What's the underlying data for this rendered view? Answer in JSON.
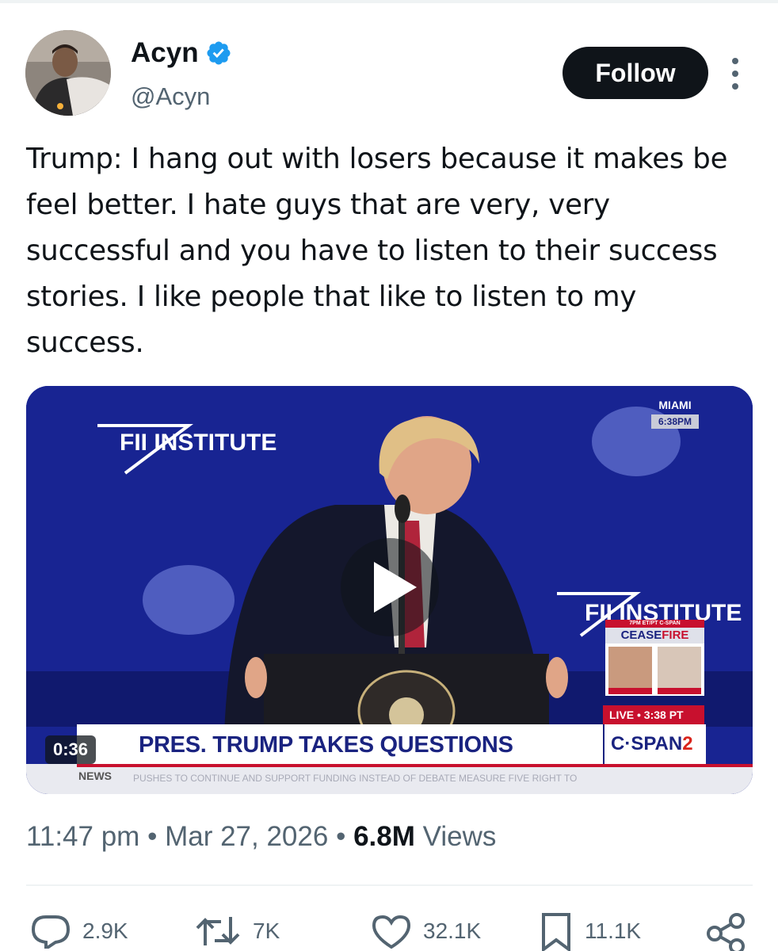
{
  "author": {
    "name": "Acyn",
    "handle": "@Acyn",
    "verified": true,
    "follow_label": "Follow"
  },
  "tweet": {
    "text": "Trump: I hang out with losers because it makes be feel better. I hate guys that are very, very successful and you have to listen to their success stories. I like people that like to listen to my success."
  },
  "video": {
    "duration": "0:36",
    "chyron": "PRES. TRUMP TAKES QUESTIONS",
    "network": "C·SPAN",
    "network_number": "2",
    "location": "MIAMI",
    "local_time": "6:38PM",
    "live_label": "LIVE • 3:38 PT",
    "news_label": "NEWS",
    "backdrop_text": "FII INSTITUTE",
    "panel_header": "7PM ET/PT C-SPAN",
    "panel_title_a": "CEASE",
    "panel_title_b": "FIRE",
    "ticker": "PUSHES TO CONTINUE AND SUPPORT FUNDING INSTEAD OF DEBATE MEASURE FIVE RIGHT TO"
  },
  "meta": {
    "time": "11:47 pm",
    "separator": "•",
    "date": "Mar 27, 2026",
    "views_count": "6.8M",
    "views_label": "Views"
  },
  "actions": {
    "replies": "2.9K",
    "reposts": "7K",
    "likes": "32.1K",
    "bookmarks": "11.1K"
  },
  "colors": {
    "text": "#0f1419",
    "secondary": "#536471",
    "verified": "#1d9bf0",
    "video_bg": "#17218a"
  }
}
